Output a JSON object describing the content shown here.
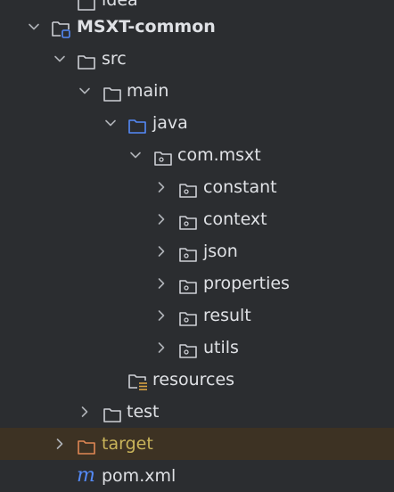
{
  "colors": {
    "background": "#2b2d30",
    "text": "#dfe1e5",
    "chevron": "#aeb1b6",
    "folder_outline": "#ced0d6",
    "source_folder": "#548af7",
    "excluded_folder": "#e08855",
    "excluded_text": "#c9b45a",
    "excluded_row_bg": "#3d3223",
    "resources_lines": "#d9a343",
    "maven_module_marker": "#548af7"
  },
  "tree": {
    "top_partial_label": "idea",
    "items": [
      {
        "label": "MSXT-common",
        "icon": "module-folder-icon",
        "state": "expanded"
      },
      {
        "label": "src",
        "icon": "folder-icon",
        "state": "expanded"
      },
      {
        "label": "main",
        "icon": "folder-icon",
        "state": "expanded"
      },
      {
        "label": "java",
        "icon": "source-root-folder-icon",
        "state": "expanded"
      },
      {
        "label": "com.msxt",
        "icon": "package-icon",
        "state": "expanded"
      },
      {
        "label": "constant",
        "icon": "package-icon",
        "state": "collapsed"
      },
      {
        "label": "context",
        "icon": "package-icon",
        "state": "collapsed"
      },
      {
        "label": "json",
        "icon": "package-icon",
        "state": "collapsed"
      },
      {
        "label": "properties",
        "icon": "package-icon",
        "state": "collapsed"
      },
      {
        "label": "result",
        "icon": "package-icon",
        "state": "collapsed"
      },
      {
        "label": "utils",
        "icon": "package-icon",
        "state": "collapsed"
      },
      {
        "label": "resources",
        "icon": "resources-folder-icon",
        "state": "leaf"
      },
      {
        "label": "test",
        "icon": "folder-icon",
        "state": "collapsed"
      },
      {
        "label": "target",
        "icon": "excluded-folder-icon",
        "state": "collapsed"
      },
      {
        "label": "pom.xml",
        "icon": "maven-file-icon",
        "state": "leaf",
        "icon_glyph": "m"
      }
    ]
  }
}
